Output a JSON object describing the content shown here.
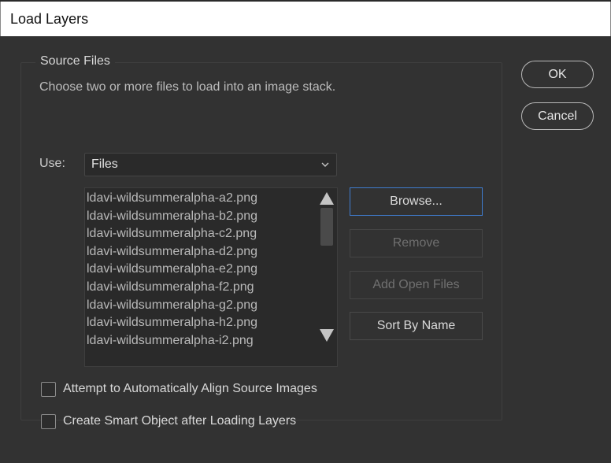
{
  "window": {
    "title": "Load Layers"
  },
  "source_files": {
    "legend": "Source Files",
    "description": "Choose two or more files to load into an image stack.",
    "use_label": "Use:",
    "use_value": "Files",
    "files": [
      "ldavi-wildsummeralpha-a2.png",
      "ldavi-wildsummeralpha-b2.png",
      "ldavi-wildsummeralpha-c2.png",
      "ldavi-wildsummeralpha-d2.png",
      "ldavi-wildsummeralpha-e2.png",
      "ldavi-wildsummeralpha-f2.png",
      "ldavi-wildsummeralpha-g2.png",
      "ldavi-wildsummeralpha-h2.png",
      "ldavi-wildsummeralpha-i2.png"
    ]
  },
  "buttons": {
    "browse": "Browse...",
    "remove": "Remove",
    "add_open_files": "Add Open Files",
    "sort_by_name": "Sort By Name",
    "ok": "OK",
    "cancel": "Cancel"
  },
  "options": {
    "auto_align": {
      "label": "Attempt to Automatically Align Source Images",
      "checked": false
    },
    "smart_object": {
      "label": "Create Smart Object after Loading Layers",
      "checked": false
    }
  },
  "colors": {
    "dialog_bg": "#323232",
    "title_bg": "#ffffff",
    "primary_border": "#3f7ccf"
  },
  "icons": {
    "dropdown": "chevron-down-icon",
    "scroll_up": "triangle-up-icon",
    "scroll_down": "triangle-down-icon"
  }
}
